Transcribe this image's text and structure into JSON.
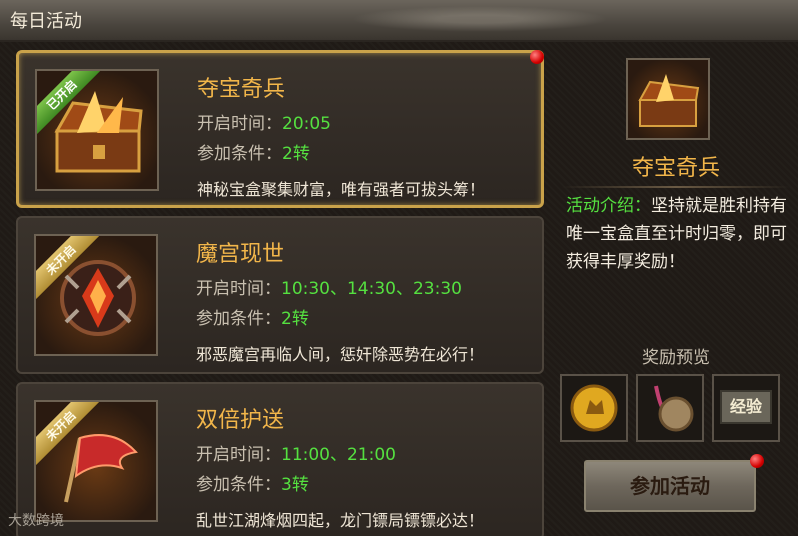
{
  "window": {
    "title": "每日活动"
  },
  "activities": [
    {
      "status": "已开启",
      "name": "夺宝奇兵",
      "time_label": "开启时间：",
      "time": "20:05",
      "cond_label": "参加条件：",
      "cond": "2转",
      "desc": "神秘宝盒聚集财富，唯有强者可拔头筹！",
      "icon": "treasure-chest-icon"
    },
    {
      "status": "未开启",
      "name": "魔宫现世",
      "time_label": "开启时间：",
      "time": "10:30、14:30、23:30",
      "cond_label": "参加条件：",
      "cond": "2转",
      "desc": "邪恶魔宫再临人间，惩奸除恶势在必行！",
      "icon": "demon-palace-icon"
    },
    {
      "status": "未开启",
      "name": "双倍护送",
      "time_label": "开启时间：",
      "time": "11:00、21:00",
      "cond_label": "参加条件：",
      "cond": "3转",
      "desc": "乱世江湖烽烟四起，龙门镖局镖镖必达！",
      "icon": "flag-icon"
    }
  ],
  "detail": {
    "name": "夺宝奇兵",
    "intro_label": "活动介绍：",
    "intro_text": "坚持就是胜利持有唯一宝盒直至计时归零，即可获得丰厚奖励！",
    "reward_title": "奖励预览",
    "rewards": [
      {
        "icon": "gold-dog-coin-icon"
      },
      {
        "icon": "bronze-medal-icon"
      },
      {
        "icon": "experience-icon",
        "label": "经验"
      }
    ],
    "join_label": "参加活动"
  },
  "watermark": "大数跨境",
  "colors": {
    "accent": "#f2b64a",
    "value_green": "#55e040",
    "open_ribbon": "#3f8a22",
    "closed_ribbon": "#b08d34"
  }
}
